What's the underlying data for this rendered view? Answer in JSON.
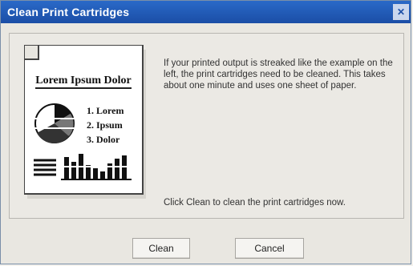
{
  "window": {
    "title": "Clean Print Cartridges",
    "close_glyph": "✕"
  },
  "main": {
    "illustration": {
      "heading": "Lorem Ipsum Dolor",
      "list": [
        "1. Lorem",
        "2. Ipsum",
        "3. Dolor"
      ]
    },
    "description": "If your printed output is streaked like the example on the left, the print cartridges need to be cleaned.  This takes about one minute and uses one sheet of paper.",
    "hint": "Click Clean to clean the print cartridges now."
  },
  "buttons": {
    "clean_label": "Clean",
    "cancel_label": "Cancel"
  }
}
